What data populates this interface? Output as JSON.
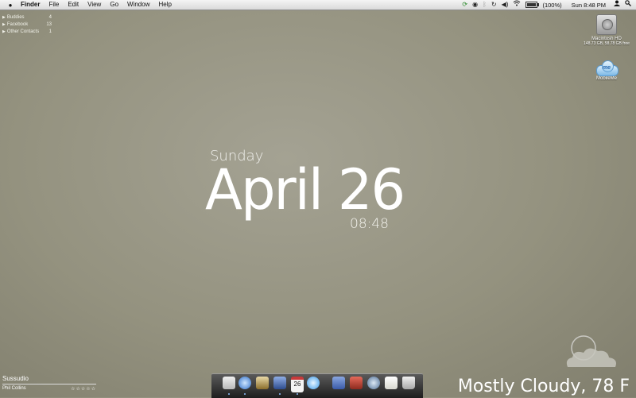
{
  "menubar": {
    "apple": "",
    "items": [
      "Finder",
      "File",
      "Edit",
      "View",
      "Go",
      "Window",
      "Help"
    ],
    "battery_percent": "(100%)",
    "clock": "Sun 8:48 PM",
    "icons": [
      "sync-icon",
      "eye-icon",
      "bluetooth-icon",
      "time-machine-icon",
      "volume-icon",
      "wifi-icon",
      "battery-icon",
      "user-icon"
    ]
  },
  "buddies": [
    {
      "label": "Buddies",
      "count": "4"
    },
    {
      "label": "Facebook",
      "count": "13"
    },
    {
      "label": "Other Contacts",
      "count": "1"
    }
  ],
  "desktop": {
    "hd_name": "Macintosh HD",
    "hd_info": "148.73 GB, 58.78 GB free",
    "mobileme_name": "MobileMe",
    "mobileme_badge": "me"
  },
  "clock": {
    "day": "Sunday",
    "date": "April 26",
    "time": "08:48"
  },
  "weather": {
    "text": "Mostly Cloudy, 78 F"
  },
  "music": {
    "title": "Sussudio",
    "artist": "Phil Collins",
    "rating": "☆☆☆☆☆"
  },
  "dock": {
    "items": [
      "mail",
      "safari",
      "terminal",
      "xcode",
      "ical",
      "itunes",
      "automator",
      "photo-booth",
      "network",
      "textedit",
      "trash"
    ],
    "colors": [
      "#dcdcdc",
      "#3a7fd8",
      "#d9c28a",
      "#4a6fb5",
      "#f2f2f2",
      "#5ab6f0",
      "#6b8ad2",
      "#c9403a",
      "#6e8fb8",
      "#f5f5f0",
      "#c8c8c8"
    ]
  }
}
